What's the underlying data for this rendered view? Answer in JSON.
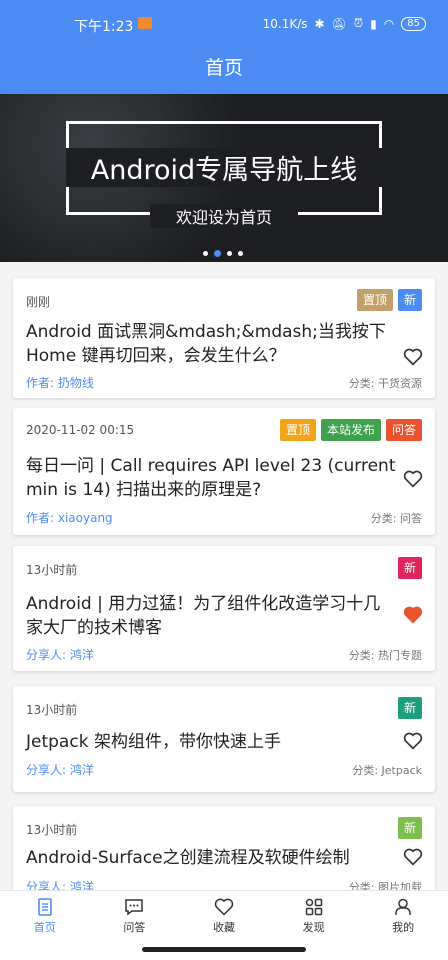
{
  "status": {
    "time": "下午1:23",
    "speed": "10.1K/s",
    "battery": "85"
  },
  "appbar": {
    "title": "首页"
  },
  "banner": {
    "title": "Android专属导航上线",
    "subtitle": "欢迎设为首页"
  },
  "articles": [
    {
      "meta": "刚刚",
      "tags": [
        {
          "label": "置顶",
          "color": "#c2a06a"
        },
        {
          "label": "新",
          "color": "#4c8cf5"
        }
      ],
      "title": "Android 面试黑洞&mdash;&mdash;当我按下 Home 键再切回来，会发生什么？",
      "author": "作者: 扔物线",
      "category": "分类: 干货资源",
      "liked": false
    },
    {
      "meta": "2020-11-02 00:15",
      "tags": [
        {
          "label": "置顶",
          "color": "#f0a419"
        },
        {
          "label": "本站发布",
          "color": "#3fa34d"
        },
        {
          "label": "问答",
          "color": "#e9542f"
        }
      ],
      "title": "每日一问 | Call requires API level 23 (current min is 14) 扫描出来的原理是?",
      "author": "作者: xiaoyang",
      "category": "分类: 问答",
      "liked": false
    },
    {
      "meta": "13小时前",
      "tags": [
        {
          "label": "新",
          "color": "#e0245e"
        }
      ],
      "title": "Android | 用力过猛！为了组件化改造学习十几家大厂的技术博客",
      "author": "分享人: 鸿洋",
      "category": "分类: 热门专题",
      "liked": true
    },
    {
      "meta": "13小时前",
      "tags": [
        {
          "label": "新",
          "color": "#1f9e7d"
        }
      ],
      "title": "Jetpack 架构组件，带你快速上手",
      "author": "分享人: 鸿洋",
      "category": "分类: Jetpack",
      "liked": false
    },
    {
      "meta": "13小时前",
      "tags": [
        {
          "label": "新",
          "color": "#7cc04b"
        }
      ],
      "title": "Android-Surface之创建流程及软硬件绘制",
      "author": "分享人: 鸿洋",
      "category": "分类: 图片加载",
      "liked": false
    }
  ],
  "tabs": [
    {
      "label": "首页",
      "icon": "home-doc-icon",
      "active": true
    },
    {
      "label": "问答",
      "icon": "chat-icon",
      "active": false
    },
    {
      "label": "收藏",
      "icon": "heart-icon",
      "active": false
    },
    {
      "label": "发现",
      "icon": "grid-icon",
      "active": false
    },
    {
      "label": "我的",
      "icon": "person-icon",
      "active": false
    }
  ]
}
